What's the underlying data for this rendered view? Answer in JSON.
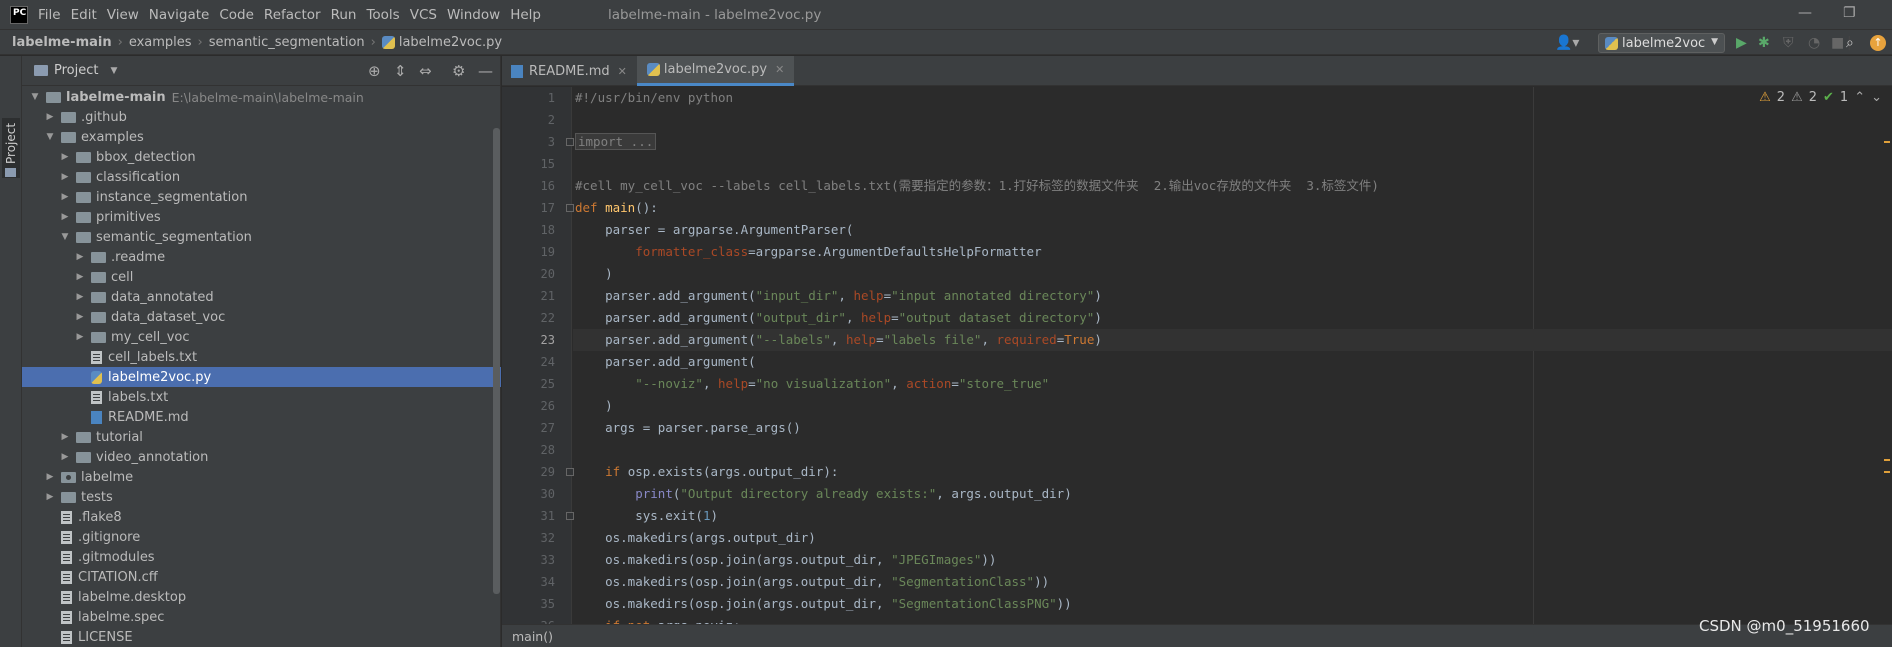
{
  "app": {
    "logo_text": "PC",
    "window_title": "labelme-main - labelme2voc.py"
  },
  "menu": [
    "File",
    "Edit",
    "View",
    "Navigate",
    "Code",
    "Refactor",
    "Run",
    "Tools",
    "VCS",
    "Window",
    "Help"
  ],
  "breadcrumbs": [
    "labelme-main",
    "examples",
    "semantic_segmentation",
    "labelme2voc.py"
  ],
  "run_config": "labelme2voc",
  "side_stripe_label": "Project",
  "project_panel": {
    "title": "Project",
    "root_name": "labelme-main",
    "root_path": "E:\\labelme-main\\labelme-main",
    "tree": [
      {
        "label": "labelme-main",
        "depth": 0,
        "type": "root",
        "expanded": true
      },
      {
        "label": ".github",
        "depth": 1,
        "type": "folder",
        "expanded": false
      },
      {
        "label": "examples",
        "depth": 1,
        "type": "folder",
        "expanded": true
      },
      {
        "label": "bbox_detection",
        "depth": 2,
        "type": "folder",
        "expanded": false
      },
      {
        "label": "classification",
        "depth": 2,
        "type": "folder",
        "expanded": false
      },
      {
        "label": "instance_segmentation",
        "depth": 2,
        "type": "folder",
        "expanded": false
      },
      {
        "label": "primitives",
        "depth": 2,
        "type": "folder",
        "expanded": false
      },
      {
        "label": "semantic_segmentation",
        "depth": 2,
        "type": "folder",
        "expanded": true
      },
      {
        "label": ".readme",
        "depth": 3,
        "type": "folder",
        "expanded": false
      },
      {
        "label": "cell",
        "depth": 3,
        "type": "folder",
        "expanded": false
      },
      {
        "label": "data_annotated",
        "depth": 3,
        "type": "folder",
        "expanded": false
      },
      {
        "label": "data_dataset_voc",
        "depth": 3,
        "type": "folder",
        "expanded": false
      },
      {
        "label": "my_cell_voc",
        "depth": 3,
        "type": "folder",
        "expanded": false
      },
      {
        "label": "cell_labels.txt",
        "depth": 3,
        "type": "file"
      },
      {
        "label": "labelme2voc.py",
        "depth": 3,
        "type": "py",
        "selected": true
      },
      {
        "label": "labels.txt",
        "depth": 3,
        "type": "file"
      },
      {
        "label": "README.md",
        "depth": 3,
        "type": "md"
      },
      {
        "label": "tutorial",
        "depth": 2,
        "type": "folder",
        "expanded": false
      },
      {
        "label": "video_annotation",
        "depth": 2,
        "type": "folder",
        "expanded": false
      },
      {
        "label": "labelme",
        "depth": 1,
        "type": "pkg",
        "expanded": false
      },
      {
        "label": "tests",
        "depth": 1,
        "type": "folder",
        "expanded": false
      },
      {
        "label": ".flake8",
        "depth": 1,
        "type": "file"
      },
      {
        "label": ".gitignore",
        "depth": 1,
        "type": "file"
      },
      {
        "label": ".gitmodules",
        "depth": 1,
        "type": "file"
      },
      {
        "label": "CITATION.cff",
        "depth": 1,
        "type": "file"
      },
      {
        "label": "labelme.desktop",
        "depth": 1,
        "type": "file"
      },
      {
        "label": "labelme.spec",
        "depth": 1,
        "type": "file"
      },
      {
        "label": "LICENSE",
        "depth": 1,
        "type": "file"
      }
    ]
  },
  "editor_tabs": [
    {
      "label": "README.md",
      "icon": "markdown-icon",
      "active": false
    },
    {
      "label": "labelme2voc.py",
      "icon": "python-icon",
      "active": true
    }
  ],
  "inspections": {
    "warnings": "2",
    "weak_warnings": "2",
    "ok": "1"
  },
  "code_lines": [
    {
      "n": "1",
      "tokens": [
        [
          "c-com",
          "#!/usr/bin/env python"
        ]
      ]
    },
    {
      "n": "2",
      "tokens": []
    },
    {
      "n": "3",
      "tokens": [
        [
          "folded",
          "import ..."
        ]
      ]
    },
    {
      "n": "15",
      "tokens": []
    },
    {
      "n": "16",
      "tokens": [
        [
          "c-com",
          "#cell my_cell_voc --labels cell_labels.txt(需要指定的参数：1.打好标签的数据文件夹  2.输出voc存放的文件夹  3.标签文件)"
        ]
      ]
    },
    {
      "n": "17",
      "tokens": [
        [
          "c-kw",
          "def "
        ],
        [
          "c-fn",
          "main"
        ],
        [
          "",
          "():"
        ]
      ]
    },
    {
      "n": "18",
      "tokens": [
        [
          "",
          "    parser = argparse.ArgumentParser("
        ]
      ]
    },
    {
      "n": "19",
      "tokens": [
        [
          "",
          "        "
        ],
        [
          "c-param",
          "formatter_class"
        ],
        [
          "",
          "=argparse.ArgumentDefaultsHelpFormatter"
        ]
      ]
    },
    {
      "n": "20",
      "tokens": [
        [
          "",
          "    )"
        ]
      ]
    },
    {
      "n": "21",
      "tokens": [
        [
          "",
          "    parser.add_argument("
        ],
        [
          "c-str",
          "\"input_dir\""
        ],
        [
          "",
          ", "
        ],
        [
          "c-param",
          "help"
        ],
        [
          "",
          "="
        ],
        [
          "c-str",
          "\"input annotated directory\""
        ],
        [
          "",
          ")"
        ]
      ]
    },
    {
      "n": "22",
      "tokens": [
        [
          "",
          "    parser.add_argument("
        ],
        [
          "c-str",
          "\"output_dir\""
        ],
        [
          "",
          ", "
        ],
        [
          "c-param",
          "help"
        ],
        [
          "",
          "="
        ],
        [
          "c-str",
          "\"output dataset directory\""
        ],
        [
          "",
          ")"
        ]
      ]
    },
    {
      "n": "23",
      "current": true,
      "tokens": [
        [
          "",
          "    parser.add_argument("
        ],
        [
          "c-str",
          "\"--labels\""
        ],
        [
          "",
          ", "
        ],
        [
          "c-param",
          "help"
        ],
        [
          "",
          "="
        ],
        [
          "c-str",
          "\"labels file\""
        ],
        [
          "",
          ", "
        ],
        [
          "c-param",
          "required"
        ],
        [
          "",
          "="
        ],
        [
          "c-kw",
          "True"
        ],
        [
          "",
          ")"
        ]
      ]
    },
    {
      "n": "24",
      "tokens": [
        [
          "",
          "    parser.add_argument("
        ]
      ]
    },
    {
      "n": "25",
      "tokens": [
        [
          "",
          "        "
        ],
        [
          "c-str",
          "\"--noviz\""
        ],
        [
          "",
          ", "
        ],
        [
          "c-param",
          "help"
        ],
        [
          "",
          "="
        ],
        [
          "c-str",
          "\"no visualization\""
        ],
        [
          "",
          ", "
        ],
        [
          "c-param",
          "action"
        ],
        [
          "",
          "="
        ],
        [
          "c-str",
          "\"store_true\""
        ]
      ]
    },
    {
      "n": "26",
      "tokens": [
        [
          "",
          "    )"
        ]
      ]
    },
    {
      "n": "27",
      "tokens": [
        [
          "",
          "    args = parser.parse_args()"
        ]
      ]
    },
    {
      "n": "28",
      "tokens": []
    },
    {
      "n": "29",
      "tokens": [
        [
          "",
          "    "
        ],
        [
          "c-kw",
          "if "
        ],
        [
          "",
          "osp.exists(args.output_dir):"
        ]
      ]
    },
    {
      "n": "30",
      "tokens": [
        [
          "",
          "        "
        ],
        [
          "c-bi",
          "print"
        ],
        [
          "",
          "("
        ],
        [
          "c-str",
          "\"Output directory already exists:\""
        ],
        [
          "",
          ", args.output_dir)"
        ]
      ]
    },
    {
      "n": "31",
      "tokens": [
        [
          "",
          "        sys.exit("
        ],
        [
          "c-num",
          "1"
        ],
        [
          "",
          ")"
        ]
      ]
    },
    {
      "n": "32",
      "tokens": [
        [
          "",
          "    os.makedirs(args.output_dir)"
        ]
      ]
    },
    {
      "n": "33",
      "tokens": [
        [
          "",
          "    os.makedirs(osp.join(args.output_dir, "
        ],
        [
          "c-str",
          "\"JPEGImages\""
        ],
        [
          "",
          "))"
        ]
      ]
    },
    {
      "n": "34",
      "tokens": [
        [
          "",
          "    os.makedirs(osp.join(args.output_dir, "
        ],
        [
          "c-str",
          "\"SegmentationClass\""
        ],
        [
          "",
          "))"
        ]
      ]
    },
    {
      "n": "35",
      "tokens": [
        [
          "",
          "    os.makedirs(osp.join(args.output_dir, "
        ],
        [
          "c-str",
          "\"SegmentationClassPNG\""
        ],
        [
          "",
          "))"
        ]
      ]
    },
    {
      "n": "36",
      "tokens": [
        [
          "",
          "    "
        ],
        [
          "c-kw",
          "if not "
        ],
        [
          "",
          "args.noviz:"
        ]
      ]
    }
  ],
  "status_breadcrumb": "main()",
  "watermark": "CSDN @m0_51951660"
}
